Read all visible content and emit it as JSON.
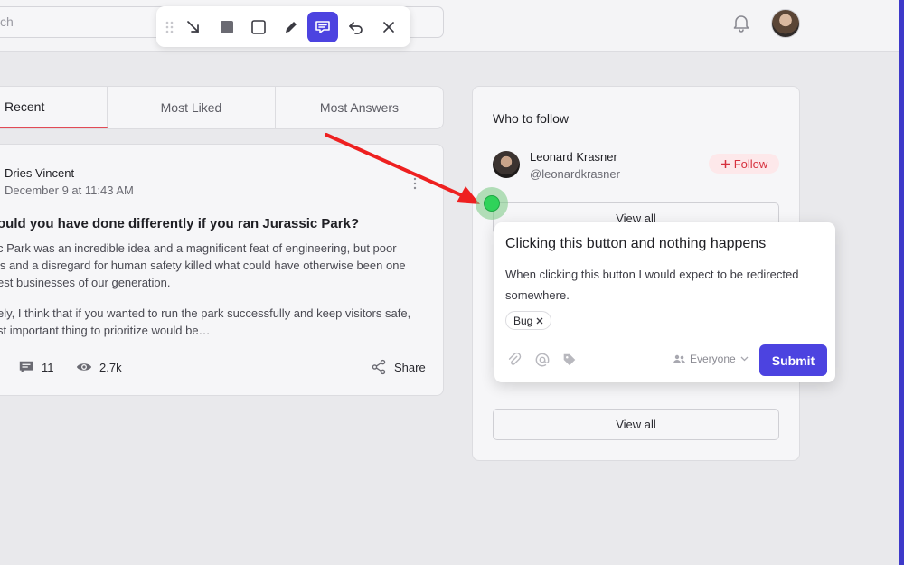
{
  "search": {
    "placeholder_fragment": "ch"
  },
  "toolbar": {
    "tools": [
      "drag-handle",
      "arrow",
      "filled-rectangle",
      "rectangle",
      "pencil",
      "comment",
      "undo",
      "close"
    ],
    "active_tool": "comment",
    "accent": "#4c43e0"
  },
  "tabs": [
    {
      "label": "Recent"
    },
    {
      "label": "Most Liked"
    },
    {
      "label": "Most Answers"
    }
  ],
  "post": {
    "author": "Dries Vincent",
    "date": "December 9 at 11:43 AM",
    "title": "ould you have done differently if you ran Jurassic Park?",
    "body_lines": [
      "c Park was an incredible idea and a magnificent feat of engineering, but poor",
      "ls and a disregard for human safety killed what could have otherwise been one",
      "est businesses of our generation.",
      "ely, I think that if you wanted to run the park successfully and keep visitors safe,",
      "st important thing to prioritize would be…"
    ],
    "comments": "11",
    "views": "2.7k",
    "share": "Share"
  },
  "follow": {
    "heading": "Who to follow",
    "name": "Leonard Krasner",
    "handle": "@leonardkrasner",
    "follow_label": "Follow",
    "view_all_top": "View all",
    "view_all_bottom": "View all"
  },
  "feedback": {
    "title": "Clicking this button and nothing happens",
    "description": "When clicking this button I would expect to be redirected somewhere.",
    "tag": "Bug",
    "audience": "Everyone",
    "submit": "Submit",
    "marker_color": "#2fd35a",
    "arrow_color": "#ee2020"
  }
}
